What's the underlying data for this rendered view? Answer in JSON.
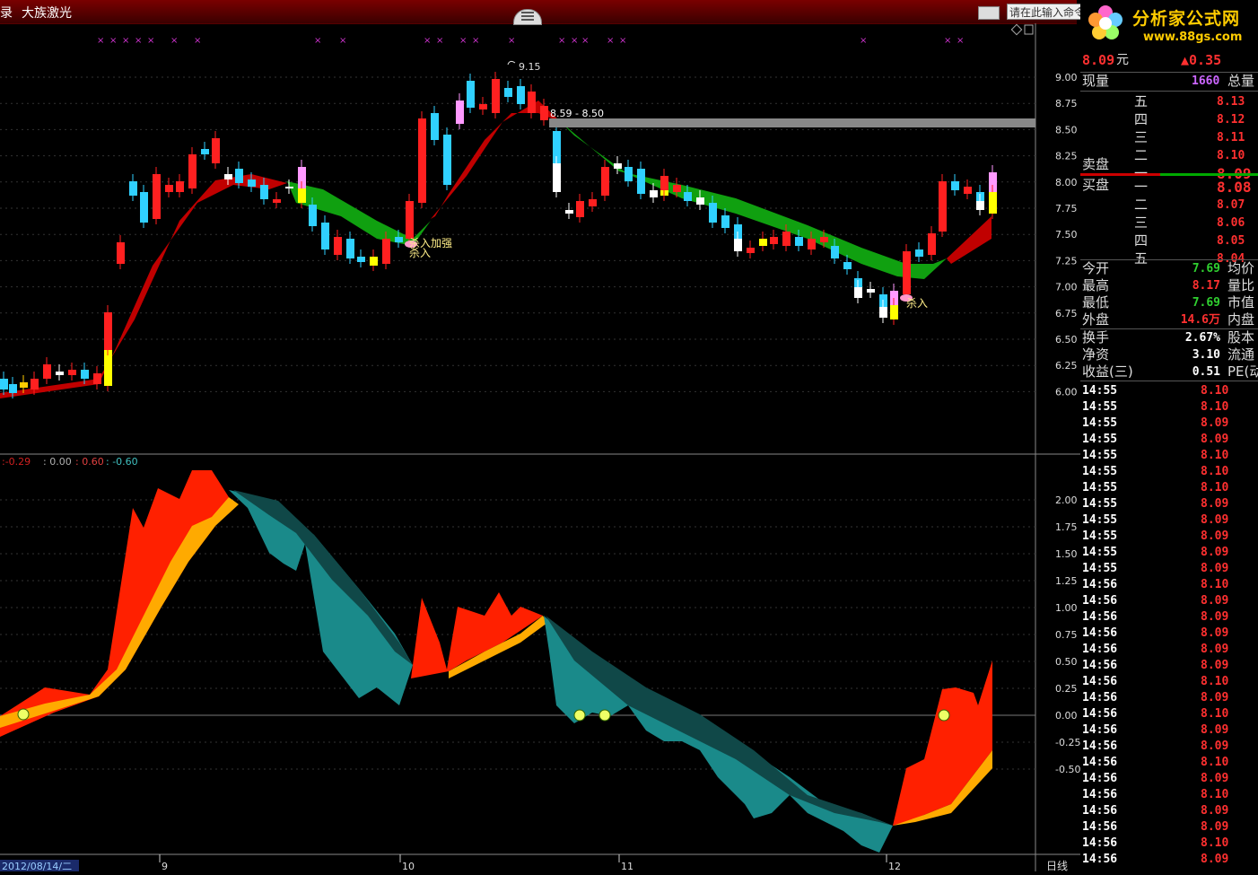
{
  "window": {
    "title_left": "录",
    "stock_name": "大族激光",
    "command_placeholder": "请在此输入命令"
  },
  "logo": {
    "brand": "分析家公式网",
    "url": "www.88gs.com"
  },
  "price_chart": {
    "y_ticks": [
      "9.00",
      "8.75",
      "8.50",
      "8.25",
      "8.00",
      "7.75",
      "7.50",
      "7.25",
      "7.00",
      "6.75",
      "6.50",
      "6.25",
      "6.00"
    ],
    "high_label": "9.15",
    "resistance_label": "8.59 - 8.50",
    "signal_labels": [
      "杀入加强",
      "杀入",
      "杀入"
    ]
  },
  "indicator": {
    "legend": [
      ":-0.29",
      ": 0.00",
      ": 0.60",
      ": -0.60"
    ],
    "legend_colors": [
      "#d02020",
      "#b0b0b0",
      "#e04040",
      "#40c0c0"
    ],
    "y_ticks": [
      "2.00",
      "1.75",
      "1.50",
      "1.25",
      "1.00",
      "0.75",
      "0.50",
      "0.25",
      "0.00",
      "-0.25",
      "-0.50"
    ]
  },
  "x_axis": {
    "date_label": "2012/08/14/二",
    "months": [
      "9",
      "10",
      "11",
      "12"
    ],
    "period": "日线"
  },
  "quote": {
    "price": "8.09",
    "unit": "元",
    "change": "▲0.35",
    "volume_label": "现量",
    "volume": "1660",
    "total_volume_label": "总量",
    "sell_label": "卖盘",
    "buy_label": "买盘",
    "asks": [
      {
        "level": "五",
        "price": "8.13"
      },
      {
        "level": "四",
        "price": "8.12"
      },
      {
        "level": "三",
        "price": "8.11"
      },
      {
        "level": "二",
        "price": "8.10"
      },
      {
        "level": "一",
        "price": "8.09"
      }
    ],
    "bids": [
      {
        "level": "一",
        "price": "8.08"
      },
      {
        "level": "二",
        "price": "8.07"
      },
      {
        "level": "三",
        "price": "8.06"
      },
      {
        "level": "四",
        "price": "8.05"
      },
      {
        "level": "五",
        "price": "8.04"
      }
    ],
    "stats": [
      {
        "label": "今开",
        "value": "7.69",
        "right": "均价",
        "color": "#30d030"
      },
      {
        "label": "最高",
        "value": "8.17",
        "right": "量比",
        "color": "#ff3030"
      },
      {
        "label": "最低",
        "value": "7.69",
        "right": "市值",
        "color": "#30d030"
      },
      {
        "label": "外盘",
        "value": "14.6万",
        "right": "内盘",
        "color": "#ff3030"
      }
    ],
    "fundamentals": [
      {
        "label": "换手",
        "value": "2.67%",
        "right": "股本"
      },
      {
        "label": "净资",
        "value": "3.10",
        "right": "流通"
      },
      {
        "label": "收益(三)",
        "value": "0.51",
        "right": "PE(动"
      }
    ]
  },
  "ticks": [
    {
      "time": "14:55",
      "price": "8.10"
    },
    {
      "time": "14:55",
      "price": "8.10"
    },
    {
      "time": "14:55",
      "price": "8.09"
    },
    {
      "time": "14:55",
      "price": "8.09"
    },
    {
      "time": "14:55",
      "price": "8.10"
    },
    {
      "time": "14:55",
      "price": "8.10"
    },
    {
      "time": "14:55",
      "price": "8.10"
    },
    {
      "time": "14:55",
      "price": "8.09"
    },
    {
      "time": "14:55",
      "price": "8.09"
    },
    {
      "time": "14:55",
      "price": "8.09"
    },
    {
      "time": "14:55",
      "price": "8.09"
    },
    {
      "time": "14:55",
      "price": "8.09"
    },
    {
      "time": "14:56",
      "price": "8.10"
    },
    {
      "time": "14:56",
      "price": "8.09"
    },
    {
      "time": "14:56",
      "price": "8.09"
    },
    {
      "time": "14:56",
      "price": "8.09"
    },
    {
      "time": "14:56",
      "price": "8.09"
    },
    {
      "time": "14:56",
      "price": "8.09"
    },
    {
      "time": "14:56",
      "price": "8.10"
    },
    {
      "time": "14:56",
      "price": "8.09"
    },
    {
      "time": "14:56",
      "price": "8.10"
    },
    {
      "time": "14:56",
      "price": "8.09"
    },
    {
      "time": "14:56",
      "price": "8.09"
    },
    {
      "time": "14:56",
      "price": "8.10"
    },
    {
      "time": "14:56",
      "price": "8.09"
    },
    {
      "time": "14:56",
      "price": "8.10"
    },
    {
      "time": "14:56",
      "price": "8.09"
    },
    {
      "time": "14:56",
      "price": "8.09"
    },
    {
      "time": "14:56",
      "price": "8.10"
    },
    {
      "time": "14:56",
      "price": "8.09"
    }
  ],
  "colors": {
    "up": "#ff2020",
    "down": "#30d0ff",
    "accent": "#ffcc00",
    "label": "#ff4040"
  }
}
